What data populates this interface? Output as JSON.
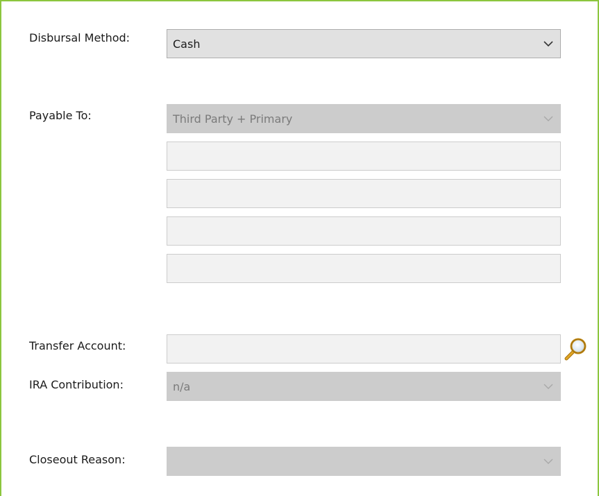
{
  "form": {
    "disbursal_method": {
      "label": "Disbursal Method:",
      "value": "Cash"
    },
    "payable_to": {
      "label": "Payable To:",
      "value": "Third Party + Primary",
      "address_lines": [
        "",
        "",
        "",
        ""
      ]
    },
    "transfer_account": {
      "label": "Transfer Account:",
      "value": ""
    },
    "ira_contribution": {
      "label": "IRA Contribution:",
      "value": "n/a"
    },
    "closeout_reason": {
      "label": "Closeout Reason:",
      "value": ""
    }
  },
  "icons": {
    "dropdown": "chevron-down-icon",
    "search": "magnifier-icon"
  },
  "colors": {
    "accent_border": "#8cc63e",
    "disabled_fill": "#cccccc",
    "input_fill": "#f2f2f2"
  }
}
